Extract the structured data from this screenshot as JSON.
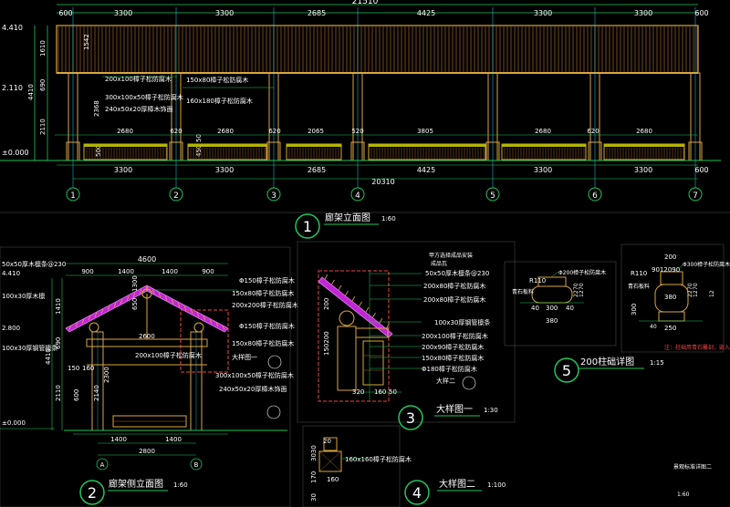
{
  "colors": {
    "background": "#000000",
    "dim_green": "#22c55e",
    "wood_orange": "#d9a640",
    "timber_brown": "#a8682a",
    "cyan_frame": "#22d3ee",
    "red_section": "#ef4444",
    "purple_roof": "#c026d3",
    "yellow_fill": "#b5b500",
    "text_white": "#ffffff"
  },
  "elevation": {
    "top_total": "21510",
    "top_dims": [
      "600",
      "3300",
      "3300",
      "2685",
      "4425",
      "3300",
      "3300",
      "600"
    ],
    "bottom_dims": [
      "3300",
      "3300",
      "2685",
      "4425",
      "3300",
      "3300",
      "600"
    ],
    "bottom_total": "20310",
    "bench_dims": [
      "2680",
      "620",
      "2680",
      "620",
      "2065",
      "520",
      "3805",
      "2680",
      "620",
      "2680"
    ],
    "left_levels": [
      "4.410",
      "2.110",
      "±0.000"
    ],
    "left_dims": [
      "1610",
      "690",
      "4410",
      "2110",
      "1542"
    ],
    "annotations": [
      "200x100樟子松防腐木",
      "300x100x50樟子松防腐木",
      "240x50x20厚樟木饰面",
      "150x80樟子松防腐木",
      "160x180樟子松防腐木"
    ],
    "vertical_dims": [
      "2368",
      "500",
      "450",
      "50"
    ],
    "axes": [
      "1",
      "2",
      "3",
      "4",
      "5",
      "6",
      "7"
    ],
    "title_number": "1",
    "title": "廊架立面图",
    "scale": "1:60"
  },
  "side": {
    "total_top": "4600",
    "top_dims": [
      "900",
      "1400",
      "1400",
      "900"
    ],
    "levels": [
      "4.410",
      "2.800",
      "±0.000"
    ],
    "left_notes": [
      "50x50厚木檩条@230",
      "100x30厚木檩",
      "100x30厚钢管檩条"
    ],
    "left_dims": [
      "1410",
      "690",
      "4410",
      "2110"
    ],
    "inner_dims": [
      "650",
      "1300",
      "2600",
      "2300",
      "150",
      "160",
      "2140",
      "600"
    ],
    "notes": [
      "Φ150樟子松防腐木",
      "150x80樟子松防腐木",
      "200x200樟子松防腐木",
      "Φ150樟子松防腐木",
      "150x80樟子松防腐木",
      "200x100樟子松防腐木",
      "300x100x50樟子松防腐木",
      "240x50x20厚樟木饰面"
    ],
    "callout": "大样图一",
    "bottom_dims": [
      "1400",
      "1400"
    ],
    "bottom_total": "2800",
    "axes": [
      "A",
      "B"
    ],
    "title_number": "2",
    "title": "廊架侧立面图",
    "scale": "1:60"
  },
  "detail1": {
    "notes": [
      "甲方选择成品安装",
      "成品瓦",
      "50x50厚木檩条@230",
      "200x80樟子松防腐木",
      "200x80樟子松防腐木",
      "100x30厚钢管檩条",
      "200x100樟子松防腐木",
      "200x90樟子松防腐木",
      "150x80樟子松防腐木",
      "Φ180樟子松防腐木",
      "大样二"
    ],
    "dims": [
      "150200",
      "200",
      "320",
      "160",
      "50"
    ],
    "title_number": "3",
    "title": "大样图一",
    "scale": "1:30"
  },
  "detail2": {
    "note": "160x160樟子松防腐木",
    "dims": [
      "20",
      "3030",
      "170",
      "30",
      "160"
    ],
    "title_number": "4",
    "title": "大样图二",
    "scale": "1:100"
  },
  "detail5": {
    "note_a": "Φ200樟子松防腐木",
    "note_b": "Φ300樟子松防腐木",
    "left_label": "青石板料",
    "right_label": "青石板料",
    "dims_a": [
      "R110",
      "40",
      "300",
      "40",
      "380",
      "70",
      "22",
      "70",
      "12"
    ],
    "dims_b": [
      "200",
      "9012090",
      "R110",
      "380",
      "300",
      "250",
      "70",
      "22",
      "70",
      "12",
      "40",
      "12"
    ],
    "red_note": "注：柱础用青石雕刻，嵌入柱础内",
    "title_number": "5",
    "title": "200柱础详图",
    "scale": "1:15"
  },
  "sheet": {
    "name": "景观标准详图二",
    "scale": "1:60"
  }
}
